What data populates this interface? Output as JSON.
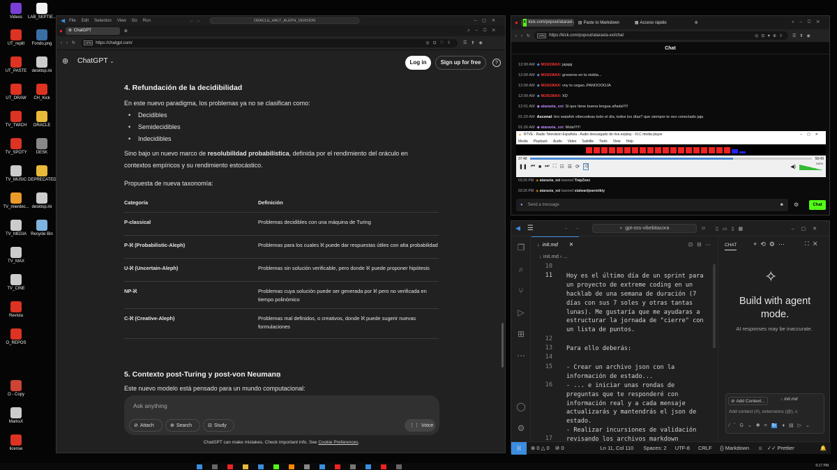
{
  "desktop": {
    "icons": [
      {
        "label": "Videos",
        "color": "#7a3fd6"
      },
      {
        "label": "LAB_SEPTIE...",
        "color": "#f2f2f2"
      },
      {
        "label": "UT_replit",
        "color": "#d32"
      },
      {
        "label": "Fondo.png",
        "color": "#3a6ea5"
      },
      {
        "label": "UT_PASTE",
        "color": "#d32"
      },
      {
        "label": "desktop.ini",
        "color": "#ccc"
      },
      {
        "label": "UT_DRAW",
        "color": "#d32"
      },
      {
        "label": "CH_Kick",
        "color": "#d32"
      },
      {
        "label": "TV_TWICH",
        "color": "#d32"
      },
      {
        "label": "ORACLE",
        "color": "#e8b93a"
      },
      {
        "label": "TV_SPOTY",
        "color": "#d32"
      },
      {
        "label": "DESK",
        "color": "#888"
      },
      {
        "label": "TV_MUSIC",
        "color": "#ccc"
      },
      {
        "label": "DEPRECATED",
        "color": "#e8b93a"
      },
      {
        "label": "TV_mierdec...",
        "color": "#e89a2a"
      },
      {
        "label": "desktop.ini",
        "color": "#ccc"
      },
      {
        "label": "TV_MEDIA",
        "color": "#ccc"
      },
      {
        "label": "Recycle Bin",
        "color": "#7fb3e0"
      },
      {
        "label": "TV_MAX",
        "color": "#ccc"
      },
      {
        "label": "TV_CINE",
        "color": "#ccc"
      },
      {
        "label": "Revista",
        "color": "#d32"
      },
      {
        "label": "O_REPOS",
        "color": "#d32"
      },
      {
        "label": "O - Copy",
        "color": "#c43"
      },
      {
        "label": "MarksX",
        "color": "#ccc"
      },
      {
        "label": "license",
        "color": "#d32"
      }
    ]
  },
  "gpt": {
    "menu": [
      "File",
      "Edit",
      "Selection",
      "View",
      "Go",
      "Run"
    ],
    "window_title": "ORACLE_HALT_ALEPH_VERSION",
    "tab_label": "ChatGPT",
    "url": "https://chatgpt.com/",
    "vpn": "VPN",
    "brand": "ChatGPT",
    "login": "Log in",
    "signup": "Sign up for free",
    "help": "?",
    "h4": "4. Refundación de la decidibilidad",
    "p1": "En este nuevo paradigma, los problemas ya no se clasifican como:",
    "bullets": [
      "Decidibles",
      "Semidecidibles",
      "Indecidibles"
    ],
    "p2_a": "Sino bajo un nuevo marco de ",
    "p2_b": "resolubilidad probabilística",
    "p2_c": ", definida por el rendimiento del oráculo en",
    "p2_d": "contextos empíricos y su rendimiento estocástico.",
    "p3": "Propuesta de nueva taxonomía:",
    "table": {
      "headers": [
        "Categoría",
        "Definición"
      ],
      "rows": [
        {
          "cat": "P-classical",
          "def": "Problemas decidibles con una máquina de Turing"
        },
        {
          "cat": "P-ℵ (Probabilistic-Aleph)",
          "def": "Problemas para los cuales ℵ puede dar respuestas útiles con alta probabilidad"
        },
        {
          "cat": "U-ℵ (Uncertain-Aleph)",
          "def": "Problemas sin solución verificable, pero donde ℵ puede proponer hipótesis"
        },
        {
          "cat": "NP-ℵ",
          "def": "Problemas cuya solución puede ser generada por ℵ pero no verificada en tiempo polinómico"
        },
        {
          "cat": "C-ℵ (Creative-Aleph)",
          "def": "Problemas mal definidos, o creativos, donde ℵ puede sugerir nuevas formulaciones"
        }
      ]
    },
    "h5": "5. Contexto post-Turing y post-von Neumann",
    "p4": "Este nuevo modelo está pensado para un mundo computacional:",
    "input_placeholder": "Ask anything",
    "attach": "Attach",
    "search": "Search",
    "study": "Study",
    "voice": "Voice",
    "footer_a": "ChatGPT can make mistakes. Check important info. See ",
    "footer_link": "Cookie Preferences",
    "footer_b": "."
  },
  "kick": {
    "tabs": [
      "kick.com/popout/ataraxi...",
      "Paste to Markdown",
      "Acceso rápido"
    ],
    "url": "https://kick.com/popout/ataraxia-xxi/chat",
    "header": "Chat",
    "lines": [
      {
        "time": "12:00 AM",
        "user": "M1N1MAX",
        "text": ": jajajaj",
        "color": "red"
      },
      {
        "time": "12:00 AM",
        "user": "M1N1MAX",
        "text": ": groseros en la niebla...",
        "color": "red"
      },
      {
        "time": "12:00 AM",
        "user": "M1N1MAX",
        "text": ": voy to cegao..PANOOOOJA",
        "color": "red"
      },
      {
        "time": "12:00 AM",
        "user": "M1N1MAX",
        "text": ": XD",
        "color": "red"
      },
      {
        "time": "12:01 AM",
        "user": "ataraxia_xxi",
        "text": ": Si que tiene buena lengua añada!!!!!",
        "color": "pink"
      },
      {
        "time": "01:20 AM",
        "user": "Ascenal",
        "text": ": bro watafok vibecodeas todo el día, todos los días? que siempre te veo conectado jaja",
        "color": "white"
      },
      {
        "time": "01:26 AM",
        "user": "ataraxia_xxi",
        "text": ": Mola!!!!!!",
        "color": "pink"
      }
    ],
    "ban_lines": [
      {
        "time": "03:26 PM",
        "user": "ataraxia_xxi",
        "action": "banned",
        "target": "TrapZeez"
      },
      {
        "time": "03:26 PM",
        "user": "ataraxia_xxi",
        "action": "banned",
        "target": "stalwartjeanmikty"
      }
    ],
    "send_placeholder": "Send a message",
    "chat_button": "Chat",
    "vlc": {
      "title": "RTVE - Radio Televisión Española - Audio descargado de rtve.es/play - VLC media player",
      "menu": [
        "Media",
        "Playback",
        "Audio",
        "Video",
        "Subtitle",
        "Tools",
        "View",
        "Help"
      ],
      "time_start": "37:48",
      "time_end": "58:49",
      "progress": 0.72,
      "volume": "100%"
    }
  },
  "vscode": {
    "search": "gpt-oss-vibebitacora",
    "tab": "init.md",
    "breadcrumb": "init.md › ...",
    "lines": [
      {
        "n": "10",
        "t": ""
      },
      {
        "n": "11",
        "t": "Hoy es el último día de un sprint para\nun proyecto de extreme coding en un\nhacklab de una semana de duración (7\ndías con sus 7 soles y otras tantas\nlunas). Me gustaría que me ayudaras a\nestructurar la jornada de \"cierre\" con\nun lista de puntos."
      },
      {
        "n": "12",
        "t": ""
      },
      {
        "n": "13",
        "t": "Para ello deberás:"
      },
      {
        "n": "14",
        "t": ""
      },
      {
        "n": "15",
        "t": "- Crear un archivo json con la\ninformación de estado..."
      },
      {
        "n": "16",
        "t": "- ... e iniciar unas rondas de\npreguntas que te responderé con\ninformación real y a cada mensaje\nactualizarás y mantendrás el json de\nestado.\n- Realizar incursiones de validación"
      },
      {
        "n": "17",
        "t": "revisando los archivos markdown"
      }
    ],
    "chat_title": "CHAT",
    "build": "Build with agent mode.",
    "ai_note": "AI responses may be inaccurate.",
    "add_context": "Add Context...",
    "ctx_file": "init.md",
    "ctx_placeholder": "Add context (#), extensions (@), c",
    "status": {
      "errors": "⊗ 0 △ 0",
      "ports": "⑩ 0",
      "pos": "Ln 11, Col 110",
      "spaces": "Spaces: 2",
      "enc": "UTF-8",
      "eol": "CRLF",
      "lang": "Markdown",
      "prettier": "Prettier"
    }
  },
  "taskbar": {
    "clock": "6:17 PM"
  }
}
